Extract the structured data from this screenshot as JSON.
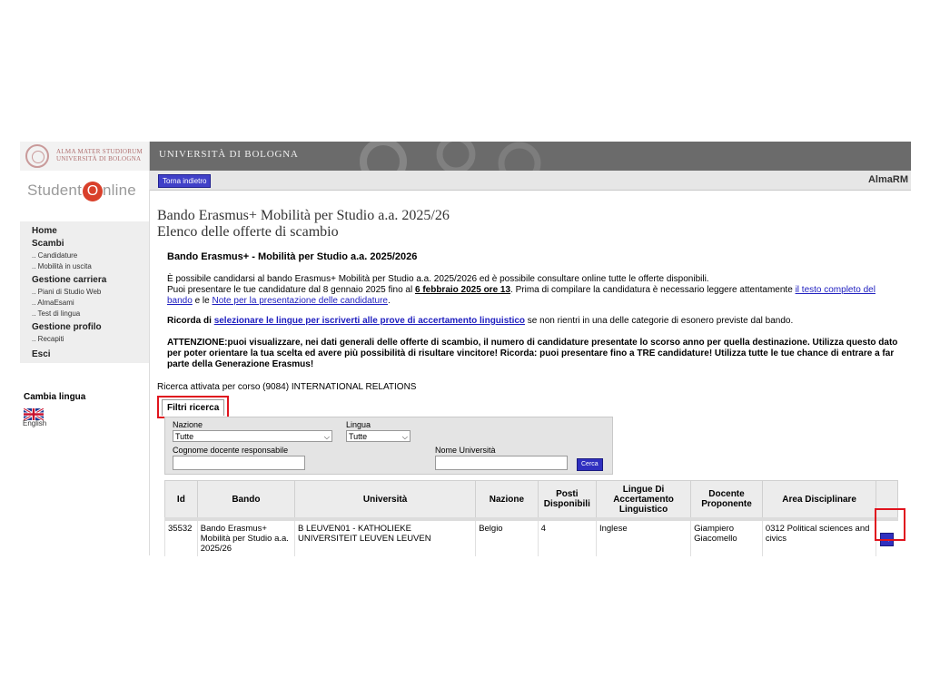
{
  "header": {
    "logo_text": [
      "ALMA MATER STUDIORUM",
      "UNIVERSITÀ DI BOLOGNA"
    ],
    "banner_title": "UNIVERSITÀ DI BOLOGNA",
    "back_button": "Torna indietro",
    "app_name": "AlmaRM"
  },
  "sidebar": {
    "logo": {
      "prefix": "Student",
      "o": "O",
      "suffix": "nline"
    },
    "home": "Home",
    "scambi": "Scambi",
    "candidature": ".. Candidature",
    "mobilita": ".. Mobilità in uscita",
    "gestione_carriera": "Gestione carriera",
    "piani": ".. Piani di Studio Web",
    "almaesami": ".. AlmaEsami",
    "test_lingua": ".. Test di lingua",
    "gestione_profilo": "Gestione profilo",
    "recapiti": ".. Recapiti",
    "esci": "Esci",
    "cambia_lingua": "Cambia lingua",
    "english": "English"
  },
  "main": {
    "title_line1": "Bando Erasmus+ Mobilità per Studio a.a. 2025/26",
    "title_line2": "Elenco delle offerte di scambio",
    "bando_title": "Bando Erasmus+ - Mobilità per Studio a.a. 2025/2026",
    "p1_line1": "È possibile candidarsi al bando Erasmus+ Mobilità per Studio a.a. 2025/2026 ed è possibile consultare online tutte le offerte disponibili.",
    "p1_a": "Puoi presentare le tue candidature dal 8 gennaio 2025 fino al ",
    "p1_deadline": "6 febbraio 2025 ore 13",
    "p1_b": ". Prima di compilare la candidatura è necessario leggere attentamente ",
    "p1_link1": "il testo completo del bando",
    "p1_c": " e le ",
    "p1_link2": "Note per la presentazione delle candidature",
    "p1_d": ".",
    "p2_a": "Ricorda di ",
    "p2_link": "selezionare le lingue per iscriverti alle prove di accertamento linguistico",
    "p2_b": " se non rientri in una delle categorie di esonero previste dal bando.",
    "p3_a": "ATTENZIONE:",
    "p3_b": "puoi visualizzare, nei dati generali delle offerte di scambio, il numero di candidature presentate lo scorso anno per quella destinazione. Utilizza questo dato per poter orientare la tua scelta ed avere più possibilità di risultare vincitore! Ricorda: puoi presentare fino a TRE candidature! Utilizza tutte le tue chance di entrare a far parte della Generazione Erasmus!",
    "research_text": "Ricerca attivata per corso (9084) INTERNATIONAL RELATIONS"
  },
  "filters": {
    "tab_label": "Filtri ricerca",
    "nazione_label": "Nazione",
    "nazione_value": "Tutte",
    "lingua_label": "Lingua",
    "lingua_value": "Tutte",
    "docente_label": "Cognome docente responsabile",
    "docente_value": "",
    "universita_label": "Nome Università",
    "universita_value": "",
    "cerca_button": "Cerca"
  },
  "table": {
    "headers": [
      "Id",
      "Bando",
      "Università",
      "Nazione",
      "Posti Disponibili",
      "Lingue Di Accertamento Linguistico",
      "Docente Proponente",
      "Area Disciplinare",
      ""
    ],
    "rows": [
      {
        "id": "35532",
        "bando": "Bando Erasmus+ Mobilità per Studio a.a. 2025/26",
        "universita": "B LEUVEN01 - KATHOLIEKE UNIVERSITEIT LEUVEN LEUVEN",
        "nazione": "Belgio",
        "posti": "4",
        "lingue": "Inglese",
        "docente": "Giampiero Giacomello",
        "area": "0312 Political sciences and civics",
        "action": "→"
      }
    ]
  },
  "colors": {
    "accent_blue": "#3030c0",
    "highlight_red": "#e0141e",
    "banner_gray": "#6b6b6b"
  }
}
